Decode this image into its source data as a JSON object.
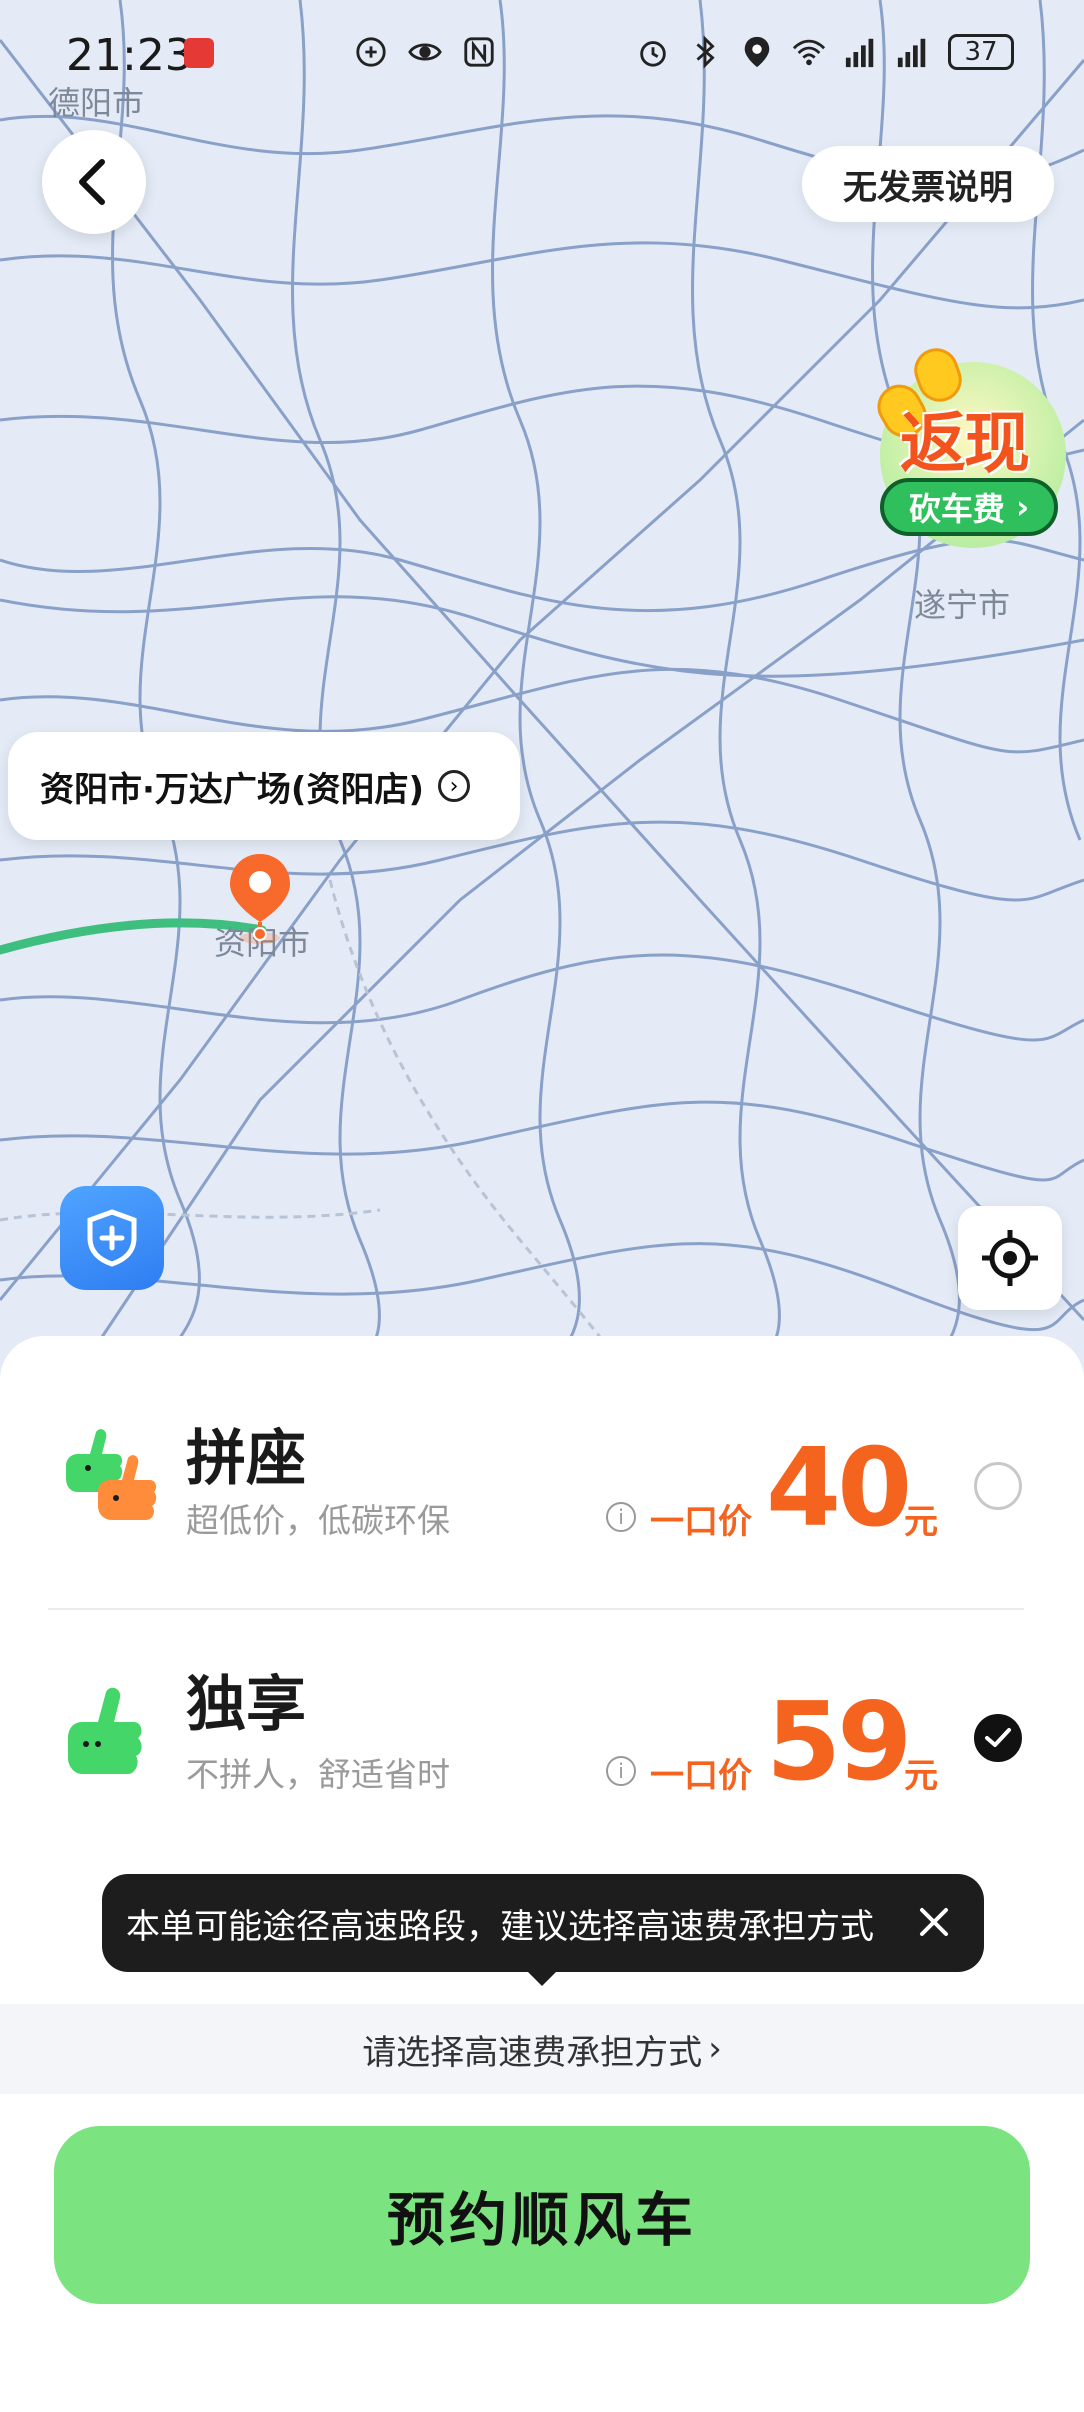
{
  "status_bar": {
    "time": "21:23",
    "battery": "37"
  },
  "map": {
    "cities": {
      "deyang": "德阳市",
      "suining": "遂宁市",
      "ziyang": "资阳市"
    },
    "place_card": "资阳市·万达广场(资阳店)",
    "invoice_button": "无发票说明",
    "cashback": {
      "title": "返现",
      "subtitle": "砍车费"
    }
  },
  "options": [
    {
      "title": "拼座",
      "desc": "超低价，低碳环保",
      "price_label": "一口价",
      "price": "40",
      "unit": "元",
      "selected": false
    },
    {
      "title": "独享",
      "desc": "不拼人，舒适省时",
      "price_label": "一口价",
      "price": "59",
      "unit": "元",
      "selected": true
    }
  ],
  "tooltip": "本单可能途径高速路段，建议选择高速费承担方式",
  "toll": {
    "label": "请选择高速费承担方式"
  },
  "book_button": "预约顺风车",
  "colors": {
    "accent_orange": "#f4641f",
    "route_green": "#3fbf7f",
    "button_green": "#7be380",
    "pin_orange": "#f86a2b"
  }
}
